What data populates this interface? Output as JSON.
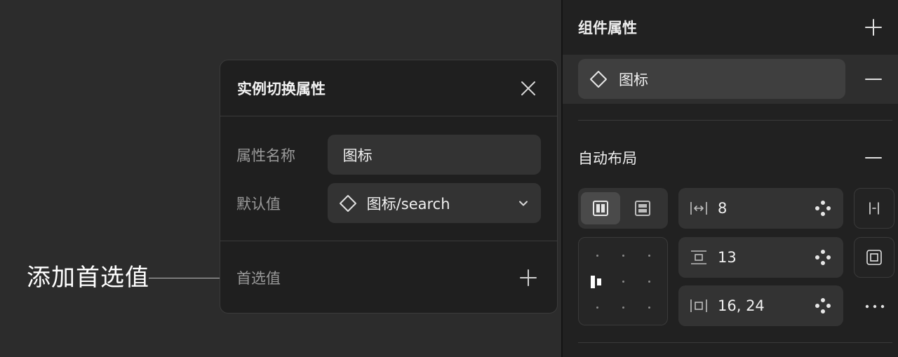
{
  "callout": {
    "text": "添加首选值"
  },
  "dialog": {
    "title": "实例切换属性",
    "fields": [
      {
        "label": "属性名称",
        "value": "图标"
      },
      {
        "label": "默认值",
        "value": "图标/search"
      }
    ],
    "footer_label": "首选值"
  },
  "panel": {
    "component_props": {
      "heading": "组件属性",
      "item_label": "图标"
    },
    "auto_layout": {
      "heading": "自动布局",
      "spacing": "8",
      "padding_vertical": "13",
      "padding": "16, 24"
    }
  },
  "icons": {
    "close": "close-icon",
    "add": "plus-icon",
    "remove": "minus-icon",
    "component": "diamond-icon",
    "dropdown": "chevron-down-icon",
    "variable": "variable-dots-icon",
    "more": "more-horizontal-icon"
  },
  "colors": {
    "canvas": "#2c2c2c",
    "dialog": "#1f1f1f",
    "field": "#333333",
    "panel": "#212121"
  }
}
